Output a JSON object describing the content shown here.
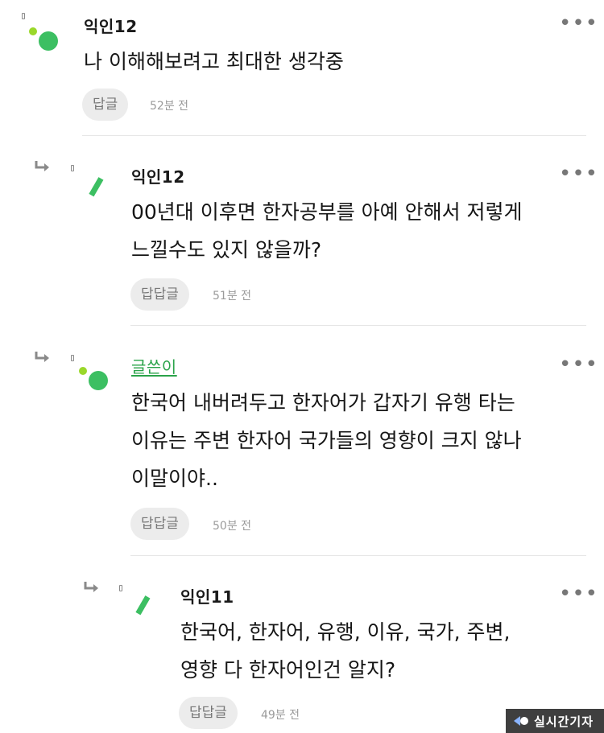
{
  "comments": [
    {
      "author": "익인12",
      "text": "나 이해해보려고 최대한 생각중",
      "reply_label": "답글",
      "time": "52분 전"
    },
    {
      "author": "익인12",
      "text": "00년대 이후면 한자공부를 아예 안해서 저렇게\n느낄수도 있지 않을까?",
      "reply_label": "답답글",
      "time": "51분 전"
    },
    {
      "author": "글쓴이",
      "text": "한국어 내버려두고 한자어가 갑자기 유행 타는\n이유는 주변 한자어 국가들의 영향이 크지 않나\n이말이야..",
      "reply_label": "답답글",
      "time": "50분 전"
    },
    {
      "author": "익인11",
      "text": "한국어, 한자어, 유행, 이유, 국가, 주변,\n영향 다 한자어인건 알지?",
      "reply_label": "답답글",
      "time": "49분 전"
    }
  ],
  "more_label": "•••",
  "watermark": {
    "text": "실시간기자"
  },
  "colors": {
    "accent_green": "#2aa34a",
    "avatar_green": "#3cbf62",
    "avatar_lime": "#9ad82a"
  }
}
